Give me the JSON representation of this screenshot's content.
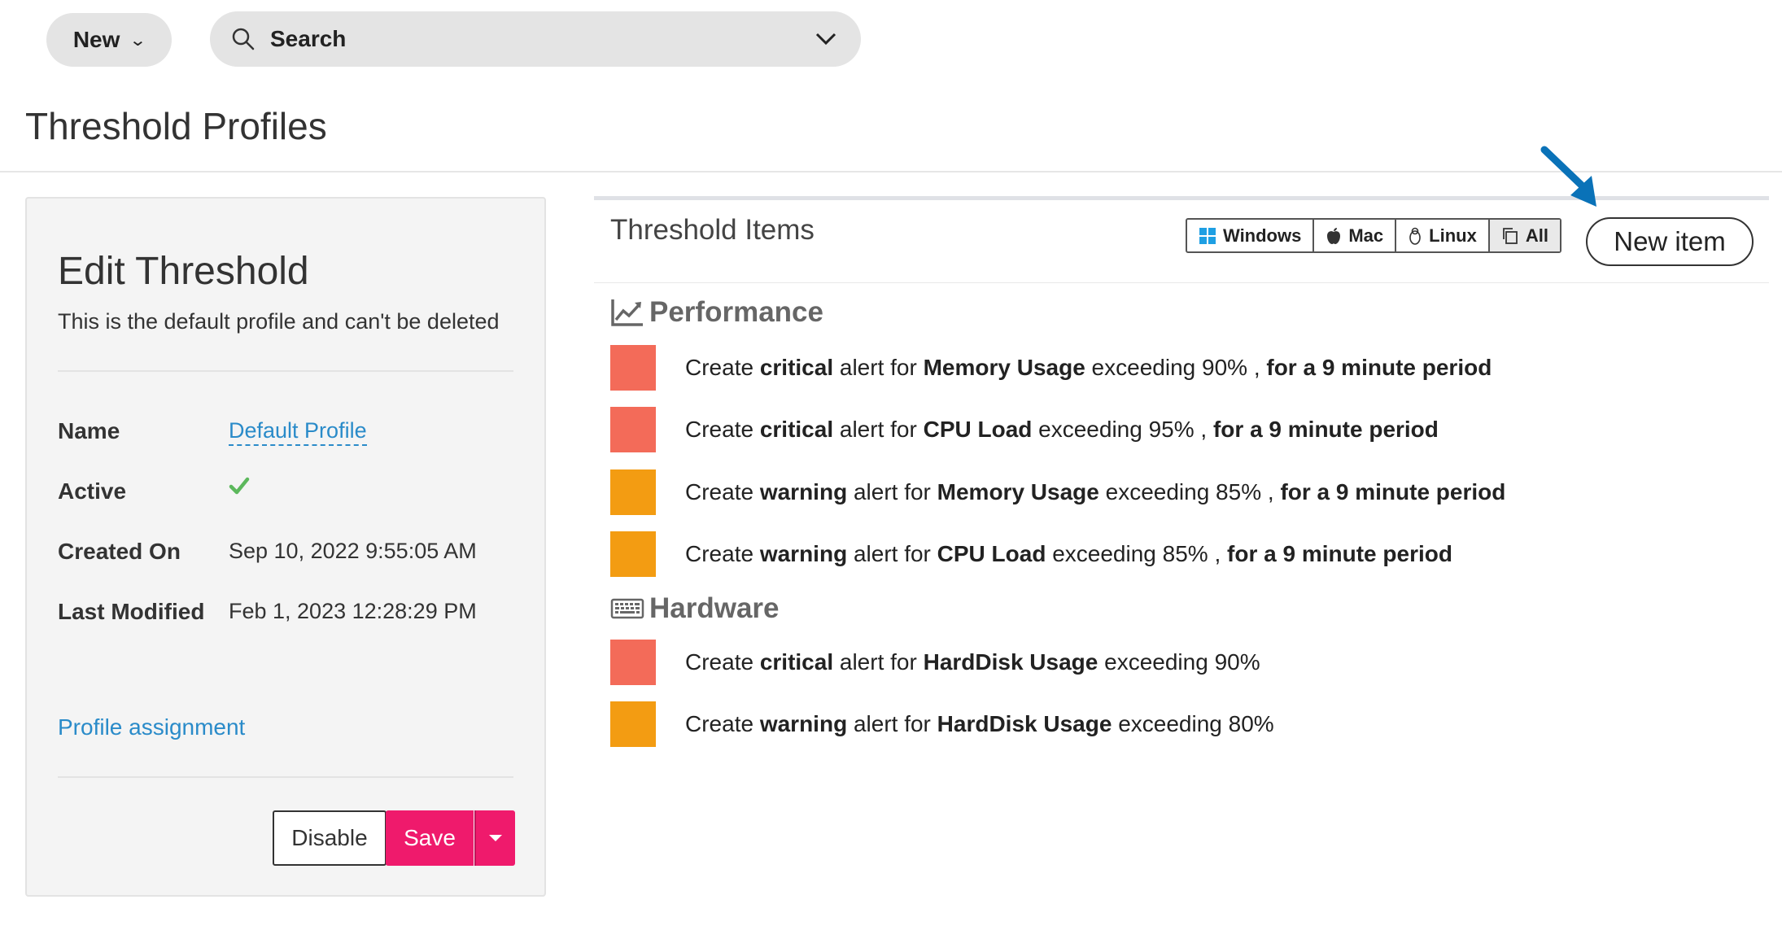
{
  "topbar": {
    "new_label": "New",
    "search_label": "Search"
  },
  "page": {
    "title": "Threshold Profiles"
  },
  "edit": {
    "title": "Edit Threshold",
    "subtitle": "This is the default profile and can't be deleted",
    "fields": {
      "name_label": "Name",
      "name_value": "Default Profile",
      "active_label": "Active",
      "active_value": true,
      "created_label": "Created On",
      "created_value": "Sep 10, 2022 9:55:05 AM",
      "modified_label": "Last Modified",
      "modified_value": "Feb 1, 2023 12:28:29 PM"
    },
    "assignment_link": "Profile assignment",
    "disable_label": "Disable",
    "save_label": "Save"
  },
  "items_panel": {
    "title": "Threshold Items",
    "os_filters": [
      "Windows",
      "Mac",
      "Linux",
      "All"
    ],
    "selected_filter": "All",
    "new_item_label": "New item",
    "sections": [
      {
        "name": "Performance",
        "icon": "line-chart-icon",
        "items": [
          {
            "severity_color": "#f36b59",
            "prefix": "Create ",
            "severity": "critical",
            "mid": " alert for ",
            "metric": "Memory Usage",
            "tail": " exceeding 90% , ",
            "period": "for a 9 minute period"
          },
          {
            "severity_color": "#f36b59",
            "prefix": "Create ",
            "severity": "critical",
            "mid": " alert for ",
            "metric": "CPU Load",
            "tail": " exceeding 95% , ",
            "period": "for a 9 minute period"
          },
          {
            "severity_color": "#f39c12",
            "prefix": "Create ",
            "severity": "warning",
            "mid": " alert for ",
            "metric": "Memory Usage",
            "tail": " exceeding 85% , ",
            "period": "for a 9 minute period"
          },
          {
            "severity_color": "#f39c12",
            "prefix": "Create ",
            "severity": "warning",
            "mid": " alert for ",
            "metric": "CPU Load",
            "tail": " exceeding 85% , ",
            "period": "for a 9 minute period"
          }
        ]
      },
      {
        "name": "Hardware",
        "icon": "keyboard-icon",
        "items": [
          {
            "severity_color": "#f36b59",
            "prefix": "Create ",
            "severity": "critical",
            "mid": " alert for ",
            "metric": "HardDisk Usage",
            "tail": " exceeding 90%",
            "period": ""
          },
          {
            "severity_color": "#f39c12",
            "prefix": "Create ",
            "severity": "warning",
            "mid": " alert for ",
            "metric": "HardDisk Usage",
            "tail": " exceeding 80%",
            "period": ""
          }
        ]
      }
    ]
  },
  "colors": {
    "accent_pink": "#ef1a6c",
    "link_blue": "#2a8bc9",
    "critical": "#f36b59",
    "warning": "#f39c12",
    "active_check": "#5cb85c"
  }
}
